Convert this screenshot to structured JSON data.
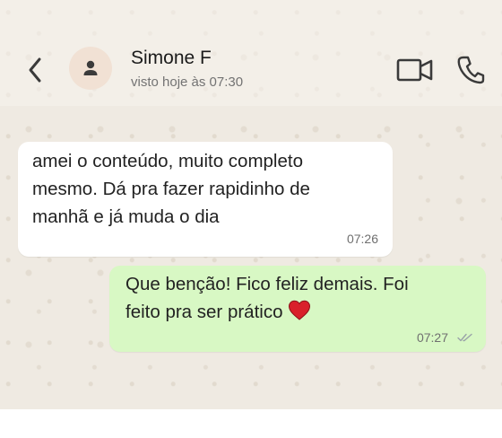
{
  "contact": {
    "name": "Simone F",
    "status": "visto hoje às 07:30"
  },
  "messages": [
    {
      "direction": "incoming",
      "text": "amei o conteúdo, muito completo\nmesmo. Dá pra fazer rapidinho de\nmanhã e já muda o dia",
      "time": "07:26"
    },
    {
      "direction": "outgoing",
      "text": "Que benção! Fico feliz demais. Foi\nfeito pra ser prático",
      "emoji": "red-heart",
      "time": "07:27",
      "status": "delivered"
    }
  ],
  "icons": {
    "back": "chevron-left-icon",
    "avatar": "person-icon",
    "video": "video-camera-icon",
    "call": "phone-icon",
    "read_status": "double-check-icon"
  },
  "colors": {
    "chat_background": "#efeae2",
    "incoming_bubble": "#ffffff",
    "outgoing_bubble": "#d8f8c4",
    "heart": "#d9202b"
  }
}
